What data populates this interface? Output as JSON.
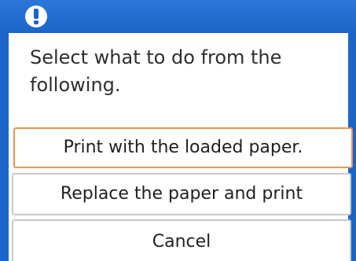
{
  "dialog": {
    "icon": "exclamation-icon",
    "message": "Select what to do from the following.",
    "accent_color": "#1b64c8",
    "focus_color": "#f09050"
  },
  "options": [
    {
      "label": "Print with the loaded paper.",
      "selected": true
    },
    {
      "label": "Replace the paper and print",
      "selected": false
    },
    {
      "label": "Cancel",
      "selected": false
    }
  ]
}
